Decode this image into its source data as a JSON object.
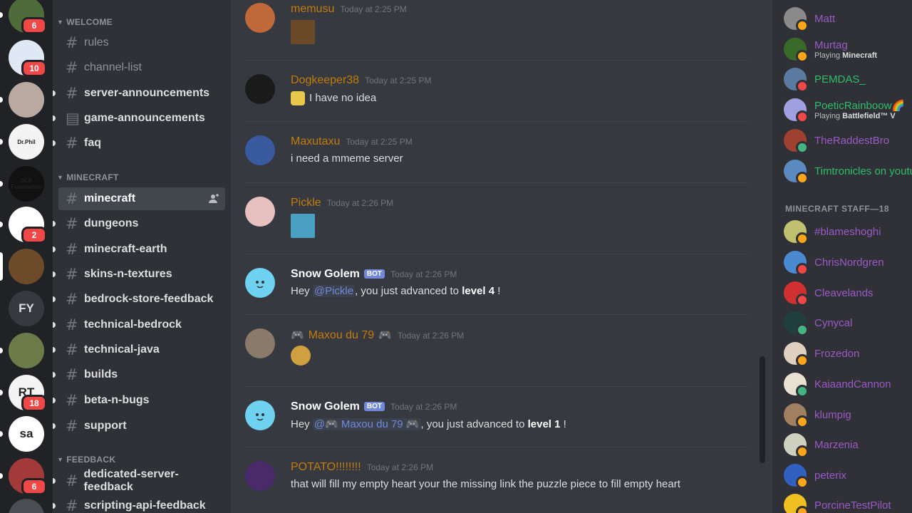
{
  "servers": [
    {
      "badge": "6",
      "color": "#4e6b3a",
      "pip": "small"
    },
    {
      "badge": "10",
      "color": "#dfe8f5",
      "pip": ""
    },
    {
      "badge": "",
      "color": "#b9a9a0",
      "pip": "small"
    },
    {
      "badge": "",
      "label": "Dr.Phil",
      "color": "#f4f4f4",
      "pip": "small"
    },
    {
      "badge": "",
      "label": "SCP Foundation",
      "color": "#111111",
      "pip": "small"
    },
    {
      "badge": "2",
      "color": "#ffffff",
      "pip": "small"
    },
    {
      "badge": "",
      "color": "#6d4a2a",
      "pip": "big"
    },
    {
      "badge": "",
      "label": "FY",
      "color": "#36393f",
      "pip": ""
    },
    {
      "badge": "",
      "color": "#6b7b4a",
      "pip": "small"
    },
    {
      "badge": "18",
      "label": "RT",
      "color": "#f4f4f4",
      "pip": "small"
    },
    {
      "badge": "",
      "label": "sa",
      "color": "#ffffff",
      "pip": "small"
    },
    {
      "badge": "6",
      "color": "#a33a3a",
      "pip": "small"
    },
    {
      "badge": "",
      "color": "#4a4d52",
      "pip": "small"
    }
  ],
  "categories": {
    "welcome": "WELCOME",
    "minecraft": "MINECRAFT",
    "feedback": "FEEDBACK"
  },
  "channels": [
    {
      "name": "rules",
      "state": "muted",
      "unread": false,
      "icon": "hash"
    },
    {
      "name": "channel-list",
      "state": "muted",
      "unread": false,
      "icon": "hash"
    },
    {
      "name": "server-announcements",
      "state": "unread",
      "unread": true,
      "icon": "hash"
    },
    {
      "name": "game-announcements",
      "state": "unread",
      "unread": true,
      "icon": "news"
    },
    {
      "name": "faq",
      "state": "unread",
      "unread": true,
      "icon": "hash"
    },
    {
      "name": "minecraft",
      "state": "active",
      "unread": false,
      "icon": "hash"
    },
    {
      "name": "dungeons",
      "state": "unread",
      "unread": true,
      "icon": "hash"
    },
    {
      "name": "minecraft-earth",
      "state": "unread",
      "unread": true,
      "icon": "hash"
    },
    {
      "name": "skins-n-textures",
      "state": "unread",
      "unread": true,
      "icon": "hash"
    },
    {
      "name": "bedrock-store-feedback",
      "state": "unread",
      "unread": true,
      "icon": "hash"
    },
    {
      "name": "technical-bedrock",
      "state": "unread",
      "unread": true,
      "icon": "hash"
    },
    {
      "name": "technical-java",
      "state": "unread",
      "unread": true,
      "icon": "hash"
    },
    {
      "name": "builds",
      "state": "unread",
      "unread": true,
      "icon": "hash"
    },
    {
      "name": "beta-n-bugs",
      "state": "unread",
      "unread": true,
      "icon": "hash"
    },
    {
      "name": "support",
      "state": "unread",
      "unread": true,
      "icon": "hash"
    },
    {
      "name": "dedicated-server-feedback",
      "state": "unread",
      "unread": true,
      "icon": "hash"
    },
    {
      "name": "scripting-api-feedback",
      "state": "unread",
      "unread": true,
      "icon": "hash"
    }
  ],
  "messages": [
    {
      "author": "memusu",
      "color": "#c27c0e",
      "time": "Today at 2:25 PM",
      "text": "",
      "avatar": "#c0683a"
    },
    {
      "author": "Dogkeeper38",
      "color": "#c27c0e",
      "time": "Today at 2:25 PM",
      "text": "I have no idea",
      "avatar": "#1a1a1a"
    },
    {
      "author": "Maxutaxu",
      "color": "#c27c0e",
      "time": "Today at 2:25 PM",
      "text": "i need  a mmeme server",
      "avatar": "#3a5aa0"
    },
    {
      "author": "Pickle",
      "color": "#c27c0e",
      "time": "Today at 2:26 PM",
      "text": "",
      "avatar": "#e8c0c0"
    },
    {
      "author": "Snow Golem",
      "color": "#ffffff",
      "bot": "BOT",
      "time": "Today at 2:26 PM",
      "pre": "Hey ",
      "mention": "@Pickle",
      "mid": ", you just advanced to ",
      "level": "level 4",
      "post": " !",
      "avatar": "#6fd2f0"
    },
    {
      "author": "Maxou du 79",
      "color": "#c27c0e",
      "time": "Today at 2:26 PM",
      "text": "",
      "avatar": "#8a7a6a"
    },
    {
      "author": "Snow Golem",
      "color": "#ffffff",
      "bot": "BOT",
      "time": "Today at 2:26 PM",
      "pre": "Hey ",
      "mention": "@🎮 Maxou du 79 🎮",
      "mid": ", you just advanced to ",
      "level": "level 1",
      "post": " !",
      "avatar": "#6fd2f0"
    },
    {
      "author": "POTATO!!!!!!!!",
      "color": "#c27c0e",
      "time": "Today at 2:26 PM",
      "text": "that will fill my empty heart your the missing link the puzzle piece to fill empty heart",
      "avatar": "#4a2a6a"
    }
  ],
  "members_top": [
    {
      "name": "Matt",
      "color": "#a55fd6",
      "activity": "",
      "game": "",
      "status": "#faa61a",
      "avatar": "#8a8a8a"
    },
    {
      "name": "Murtag",
      "color": "#a55fd6",
      "activity": "Playing ",
      "game": "Minecraft",
      "status": "#faa61a",
      "avatar": "#3a6a2a"
    },
    {
      "name": "PEMDAS_",
      "color": "#2ecc71",
      "activity": "",
      "game": "",
      "status": "#f04747",
      "avatar": "#5a7aa0"
    },
    {
      "name": "PoeticRainboow🌈",
      "color": "#2ecc71",
      "activity": "Playing ",
      "game": "Battlefield™ V",
      "status": "#f04747",
      "avatar": "#a0a0e0"
    },
    {
      "name": "TheRaddestBro",
      "color": "#a55fd6",
      "activity": "",
      "game": "",
      "status": "#43b581",
      "avatar": "#a04030"
    },
    {
      "name": "Timtronicles on youtube",
      "color": "#2ecc71",
      "activity": "",
      "game": "",
      "status": "#faa61a",
      "avatar": "#5a8ac0"
    }
  ],
  "staff_header": "MINECRAFT STAFF—18",
  "members_staff": [
    {
      "name": "#blameshoghi",
      "color": "#a55fd6",
      "status": "#faa61a",
      "avatar": "#c0c070"
    },
    {
      "name": "ChrisNordgren",
      "color": "#a55fd6",
      "status": "#f04747",
      "avatar": "#4a8ad0"
    },
    {
      "name": "Cleavelands",
      "color": "#a55fd6",
      "status": "#f04747",
      "avatar": "#d03030"
    },
    {
      "name": "Cynycal",
      "color": "#a55fd6",
      "status": "#43b581",
      "avatar": "#204040"
    },
    {
      "name": "Frozedon",
      "color": "#a55fd6",
      "status": "#faa61a",
      "avatar": "#e0d0c0"
    },
    {
      "name": "KaiaandCannon",
      "color": "#a55fd6",
      "status": "#43b581",
      "avatar": "#e8e0d0"
    },
    {
      "name": "klumpig",
      "color": "#a55fd6",
      "status": "#faa61a",
      "avatar": "#a08060"
    },
    {
      "name": "Marzenia",
      "color": "#a55fd6",
      "status": "#faa61a",
      "avatar": "#d0d0c0"
    },
    {
      "name": "peterix",
      "color": "#a55fd6",
      "status": "#faa61a",
      "avatar": "#3060c0"
    },
    {
      "name": "PorcineTestPilot",
      "color": "#a55fd6",
      "status": "#faa61a",
      "avatar": "#f0c020"
    }
  ]
}
